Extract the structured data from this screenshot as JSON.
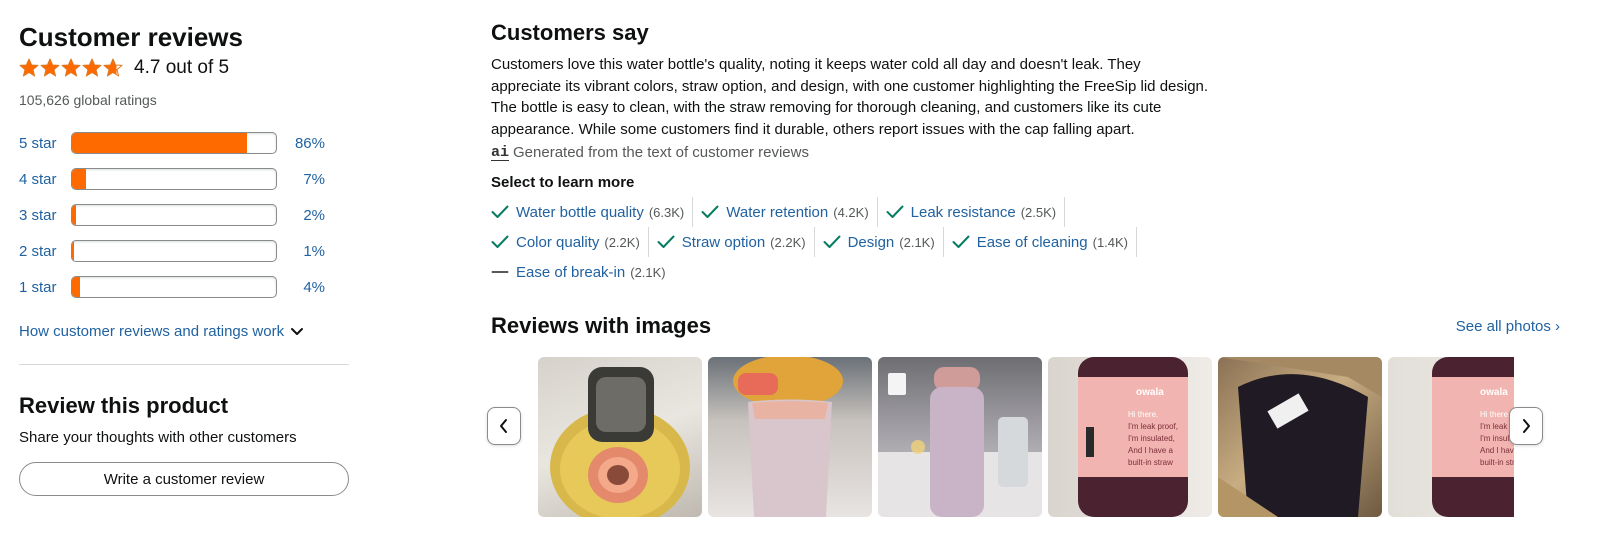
{
  "customer_reviews": {
    "title": "Customer reviews",
    "rating_text": "4.7 out of 5",
    "rating_value": 4.7,
    "star_color": "#ff6a00",
    "global_ratings": "105,626 global ratings",
    "histogram": [
      {
        "label": "5 star",
        "pct_text": "86%",
        "pct": 86
      },
      {
        "label": "4 star",
        "pct_text": "7%",
        "pct": 7
      },
      {
        "label": "3 star",
        "pct_text": "2%",
        "pct": 2
      },
      {
        "label": "2 star",
        "pct_text": "1%",
        "pct": 1
      },
      {
        "label": "1 star",
        "pct_text": "4%",
        "pct": 4
      }
    ],
    "how_link": "How customer reviews and ratings work"
  },
  "review_product": {
    "title": "Review this product",
    "subtitle": "Share your thoughts with other customers",
    "button_label": "Write a customer review"
  },
  "customers_say": {
    "title": "Customers say",
    "summary": "Customers love this water bottle's quality, noting it keeps water cold all day and doesn't leak. They appreciate its vibrant colors, straw option, and design, with one customer highlighting the FreeSip lid design. The bottle is easy to clean, with the straw removing for thorough cleaning, and customers like its cute appearance. While some customers find it durable, others report issues with the cap falling apart.",
    "ai_icon_text": "ai",
    "generated_note": "Generated from the text of customer reviews",
    "select_title": "Select to learn more",
    "aspects": [
      {
        "name": "Water bottle quality",
        "count": "(6.3K)",
        "icon": "check-icon"
      },
      {
        "name": "Water retention",
        "count": "(4.2K)",
        "icon": "check-icon"
      },
      {
        "name": "Leak resistance",
        "count": "(2.5K)",
        "icon": "check-icon"
      },
      {
        "name": "Color quality",
        "count": "(2.2K)",
        "icon": "check-icon"
      },
      {
        "name": "Straw option",
        "count": "(2.2K)",
        "icon": "check-icon"
      },
      {
        "name": "Design",
        "count": "(2.1K)",
        "icon": "check-icon"
      },
      {
        "name": "Ease of cleaning",
        "count": "(1.4K)",
        "icon": "check-icon"
      },
      {
        "name": "Ease of break-in",
        "count": "(2.1K)",
        "icon": "dash-icon"
      }
    ],
    "check_color": "#067d62",
    "link_color": "#2162a1"
  },
  "reviews_with_images": {
    "title": "Reviews with images",
    "see_all": "See all photos ›",
    "thumbnails": [
      {
        "label_text": ""
      },
      {
        "label_text": ""
      },
      {
        "label_text": ""
      },
      {
        "label_text": "owala\nHi there.\nI'm leak proof,\nI'm insulated,\nAnd I have a\nbuilt-in straw"
      },
      {
        "label_text": ""
      },
      {
        "label_text": "owala\nHi there.\nI'm leak proof,\nI'm insulated,\nAnd I have a\nbuilt-in straw"
      }
    ]
  }
}
